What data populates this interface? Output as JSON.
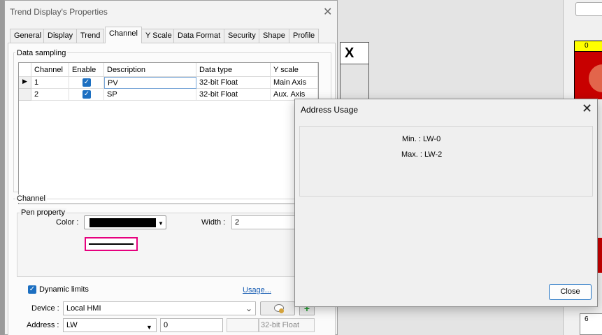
{
  "properties_dialog": {
    "title": "Trend Display's Properties",
    "tabs": [
      "General",
      "Display",
      "Trend",
      "Channel",
      "Y Scale",
      "Data Format",
      "Security",
      "Shape",
      "Profile"
    ],
    "active_tab": "Channel",
    "data_sampling": {
      "label": "Data sampling",
      "columns": [
        "Channel",
        "Enable",
        "Description",
        "Data type",
        "Y scale"
      ],
      "rows": [
        {
          "channel": "1",
          "enabled": true,
          "description": "PV",
          "data_type": "32-bit Float",
          "y_scale": "Main Axis"
        },
        {
          "channel": "2",
          "enabled": true,
          "description": "SP",
          "data_type": "32-bit Float",
          "y_scale": "Aux. Axis"
        }
      ]
    },
    "channel": {
      "label": "Channel",
      "pen_property_label": "Pen property",
      "color_label": "Color :",
      "color_value": "#000000",
      "width_label": "Width :",
      "width_value": "2",
      "preview_border_color": "#e6007e",
      "dynamic_limits_label": "Dynamic limits",
      "dynamic_limits_checked": true,
      "usage_link": "Usage...",
      "device_label": "Device :",
      "device_value": "Local HMI",
      "address_label": "Address :",
      "address_type": "LW",
      "address_value": "0",
      "address_data_type": "32-bit Float"
    }
  },
  "address_usage_dialog": {
    "title": "Address Usage",
    "min_text": "Min. : LW-0",
    "max_text": "Max. : LW-2",
    "close_label": "Close"
  },
  "background": {
    "box_x_label": "X",
    "yellow_label": "0",
    "six_label": "6"
  }
}
